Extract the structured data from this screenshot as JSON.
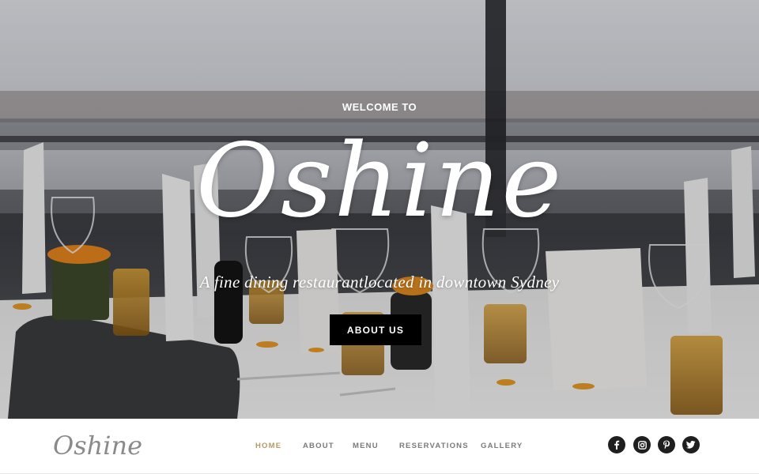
{
  "hero": {
    "kicker": "WELCOME TO",
    "brand": "Oshine",
    "tagline": "A fine dining restaurantlocated in downtown Sydney",
    "cta_label": "ABOUT US"
  },
  "navbar": {
    "logo": "Oshine",
    "items": [
      {
        "label": "HOME",
        "active": true
      },
      {
        "label": "ABOUT",
        "active": false
      },
      {
        "label": "MENU",
        "active": false
      },
      {
        "label": "RESERVATIONS",
        "active": false
      },
      {
        "label": "GALLERY",
        "active": false
      }
    ],
    "social": [
      {
        "icon": "facebook-icon"
      },
      {
        "icon": "instagram-icon"
      },
      {
        "icon": "pinterest-icon"
      },
      {
        "icon": "twitter-icon"
      }
    ]
  },
  "colors": {
    "accent": "#b39b66",
    "nav_text": "#7a7a7a",
    "button_bg": "#000000",
    "social_bg": "#1f1f1f"
  }
}
